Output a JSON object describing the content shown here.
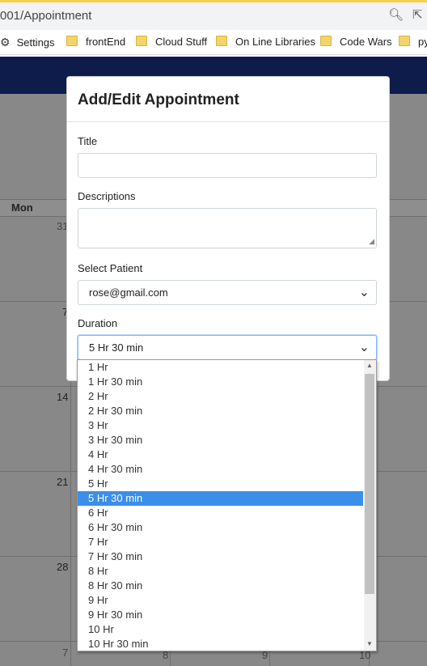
{
  "browser": {
    "url": "001/Appointment",
    "bookmarks": [
      "Settings",
      "frontEnd",
      "Cloud Stuff",
      "On Line Libraries",
      "Code Wars",
      "py"
    ]
  },
  "calendar": {
    "day_header": "Mon",
    "day_numbers": [
      "31",
      "7",
      "14",
      "21",
      "28",
      "7",
      "8",
      "9",
      "10"
    ]
  },
  "modal": {
    "title": "Add/Edit Appointment",
    "title_label": "Title",
    "title_value": "",
    "descriptions_label": "Descriptions",
    "descriptions_value": "",
    "patient_label": "Select Patient",
    "patient_value": "rose@gmail.com",
    "duration_label": "Duration",
    "duration_value": "5 Hr 30 min"
  },
  "duration_options": [
    "1 Hr",
    "1 Hr 30 min",
    "2 Hr",
    "2 Hr 30 min",
    "3 Hr",
    "3 Hr 30 min",
    "4 Hr",
    "4 Hr 30 min",
    "5 Hr",
    "5 Hr 30 min",
    "6 Hr",
    "6 Hr 30 min",
    "7 Hr",
    "7 Hr 30 min",
    "8 Hr",
    "8 Hr 30 min",
    "9 Hr",
    "9 Hr 30 min",
    "10 Hr",
    "10 Hr 30 min"
  ],
  "colors": {
    "nav_bar": "#0e1c4b",
    "selected_option": "#3b8eea",
    "overlay": "#888888"
  }
}
